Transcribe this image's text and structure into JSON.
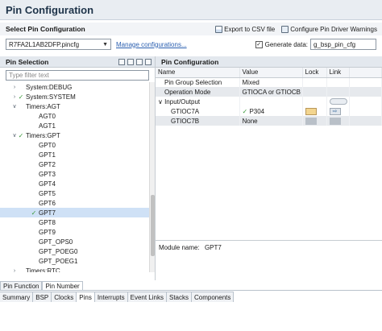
{
  "header": {
    "title": "Pin Configuration"
  },
  "select_section": {
    "label": "Select Pin Configuration",
    "export_label": "Export to CSV file",
    "driver_warnings_label": "Configure Pin Driver Warnings",
    "pincfg_value": "R7FA2L1AB2DFP.pincfg",
    "manage_link": "Manage configurations...",
    "generate_label": "Generate data:",
    "generate_checked": true,
    "generate_value": "g_bsp_pin_cfg"
  },
  "pin_selection": {
    "label": "Pin Selection",
    "filter_placeholder": "Type filter text",
    "tree": [
      {
        "label": "System:DEBUG",
        "indent": 1,
        "twisty": ">",
        "check": false,
        "selected": false
      },
      {
        "label": "System:SYSTEM",
        "indent": 1,
        "twisty": ">",
        "check": true,
        "selected": false
      },
      {
        "label": "Timers:AGT",
        "indent": 1,
        "twisty": "v",
        "check": false,
        "selected": false
      },
      {
        "label": "AGT0",
        "indent": 3,
        "twisty": "",
        "check": false,
        "selected": false
      },
      {
        "label": "AGT1",
        "indent": 3,
        "twisty": "",
        "check": false,
        "selected": false
      },
      {
        "label": "Timers:GPT",
        "indent": 1,
        "twisty": "v",
        "check": true,
        "selected": false
      },
      {
        "label": "GPT0",
        "indent": 3,
        "twisty": "",
        "check": false,
        "selected": false
      },
      {
        "label": "GPT1",
        "indent": 3,
        "twisty": "",
        "check": false,
        "selected": false
      },
      {
        "label": "GPT2",
        "indent": 3,
        "twisty": "",
        "check": false,
        "selected": false
      },
      {
        "label": "GPT3",
        "indent": 3,
        "twisty": "",
        "check": false,
        "selected": false
      },
      {
        "label": "GPT4",
        "indent": 3,
        "twisty": "",
        "check": false,
        "selected": false
      },
      {
        "label": "GPT5",
        "indent": 3,
        "twisty": "",
        "check": false,
        "selected": false
      },
      {
        "label": "GPT6",
        "indent": 3,
        "twisty": "",
        "check": false,
        "selected": false
      },
      {
        "label": "GPT7",
        "indent": 3,
        "twisty": "",
        "check": true,
        "selected": true
      },
      {
        "label": "GPT8",
        "indent": 3,
        "twisty": "",
        "check": false,
        "selected": false
      },
      {
        "label": "GPT9",
        "indent": 3,
        "twisty": "",
        "check": false,
        "selected": false
      },
      {
        "label": "GPT_OPS0",
        "indent": 3,
        "twisty": "",
        "check": false,
        "selected": false
      },
      {
        "label": "GPT_POEG0",
        "indent": 3,
        "twisty": "",
        "check": false,
        "selected": false
      },
      {
        "label": "GPT_POEG1",
        "indent": 3,
        "twisty": "",
        "check": false,
        "selected": false
      },
      {
        "label": "Timers:RTC",
        "indent": 1,
        "twisty": ">",
        "check": false,
        "selected": false
      }
    ]
  },
  "pin_config": {
    "label": "Pin Configuration",
    "columns": [
      "Name",
      "Value",
      "Lock",
      "Link"
    ],
    "rows": [
      {
        "name": "Pin Group Selection",
        "value": "Mixed",
        "indent": 1,
        "shaded": false,
        "check": false,
        "lock": "",
        "link": ""
      },
      {
        "name": "Operation Mode",
        "value": "GTIOCA or GTIOCB",
        "indent": 1,
        "shaded": true,
        "check": false,
        "lock": "",
        "link": ""
      },
      {
        "name": "Input/Output",
        "value": "",
        "indent": 0,
        "shaded": false,
        "check": false,
        "lock": "",
        "link": "io"
      },
      {
        "name": "GTIOC7A",
        "value": "P304",
        "indent": 2,
        "shaded": false,
        "check": true,
        "lock": "lock",
        "link": "arrow"
      },
      {
        "name": "GTIOC7B",
        "value": "None",
        "indent": 2,
        "shaded": true,
        "check": false,
        "lock": "dots",
        "link": "dots"
      }
    ],
    "module_label": "Module name:",
    "module_value": "GPT7"
  },
  "tabs_top": [
    {
      "label": "Pin Function",
      "active": false
    },
    {
      "label": "Pin Number",
      "active": true
    }
  ],
  "tabs_bottom": [
    {
      "label": "Summary",
      "active": false
    },
    {
      "label": "BSP",
      "active": false
    },
    {
      "label": "Clocks",
      "active": false
    },
    {
      "label": "Pins",
      "active": true
    },
    {
      "label": "Interrupts",
      "active": false
    },
    {
      "label": "Event Links",
      "active": false
    },
    {
      "label": "Stacks",
      "active": false
    },
    {
      "label": "Components",
      "active": false
    }
  ],
  "colors": {
    "accent": "#2a5fb0",
    "selection": "#cfe1f6",
    "check": "#3b9a3b"
  }
}
